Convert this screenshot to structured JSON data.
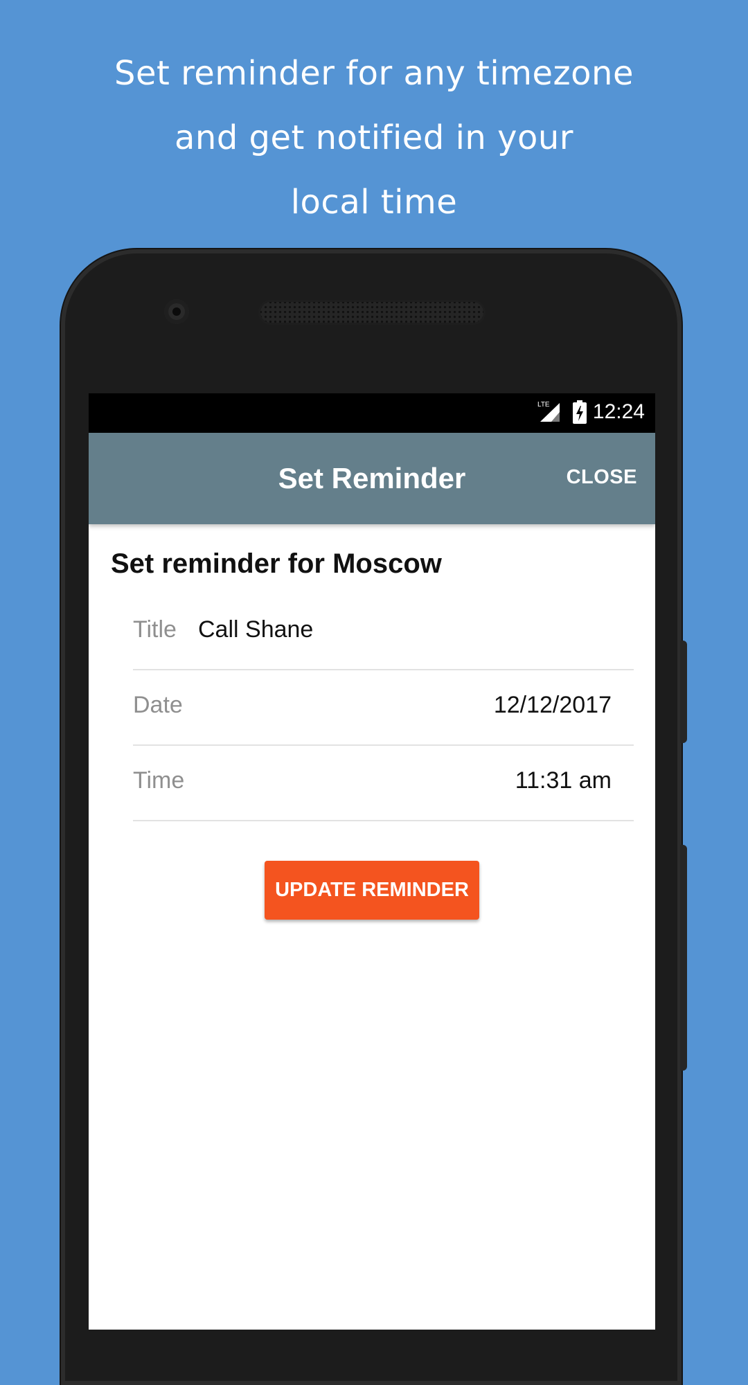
{
  "promo": {
    "line1": "Set reminder for any timezone",
    "line2": "and get notified in your",
    "line3": "local time"
  },
  "status_bar": {
    "network": "LTE",
    "time": "12:24"
  },
  "app_bar": {
    "title": "Set Reminder",
    "close_label": "CLOSE"
  },
  "form": {
    "heading": "Set reminder for Moscow",
    "fields": [
      {
        "label": "Title",
        "value": "Call Shane"
      },
      {
        "label": "Date",
        "value": "12/12/2017"
      },
      {
        "label": "Time",
        "value": "11:31 am"
      }
    ],
    "submit_label": "UPDATE REMINDER"
  },
  "colors": {
    "background": "#5594d4",
    "app_bar": "#647f8b",
    "accent_button": "#f4541f"
  }
}
